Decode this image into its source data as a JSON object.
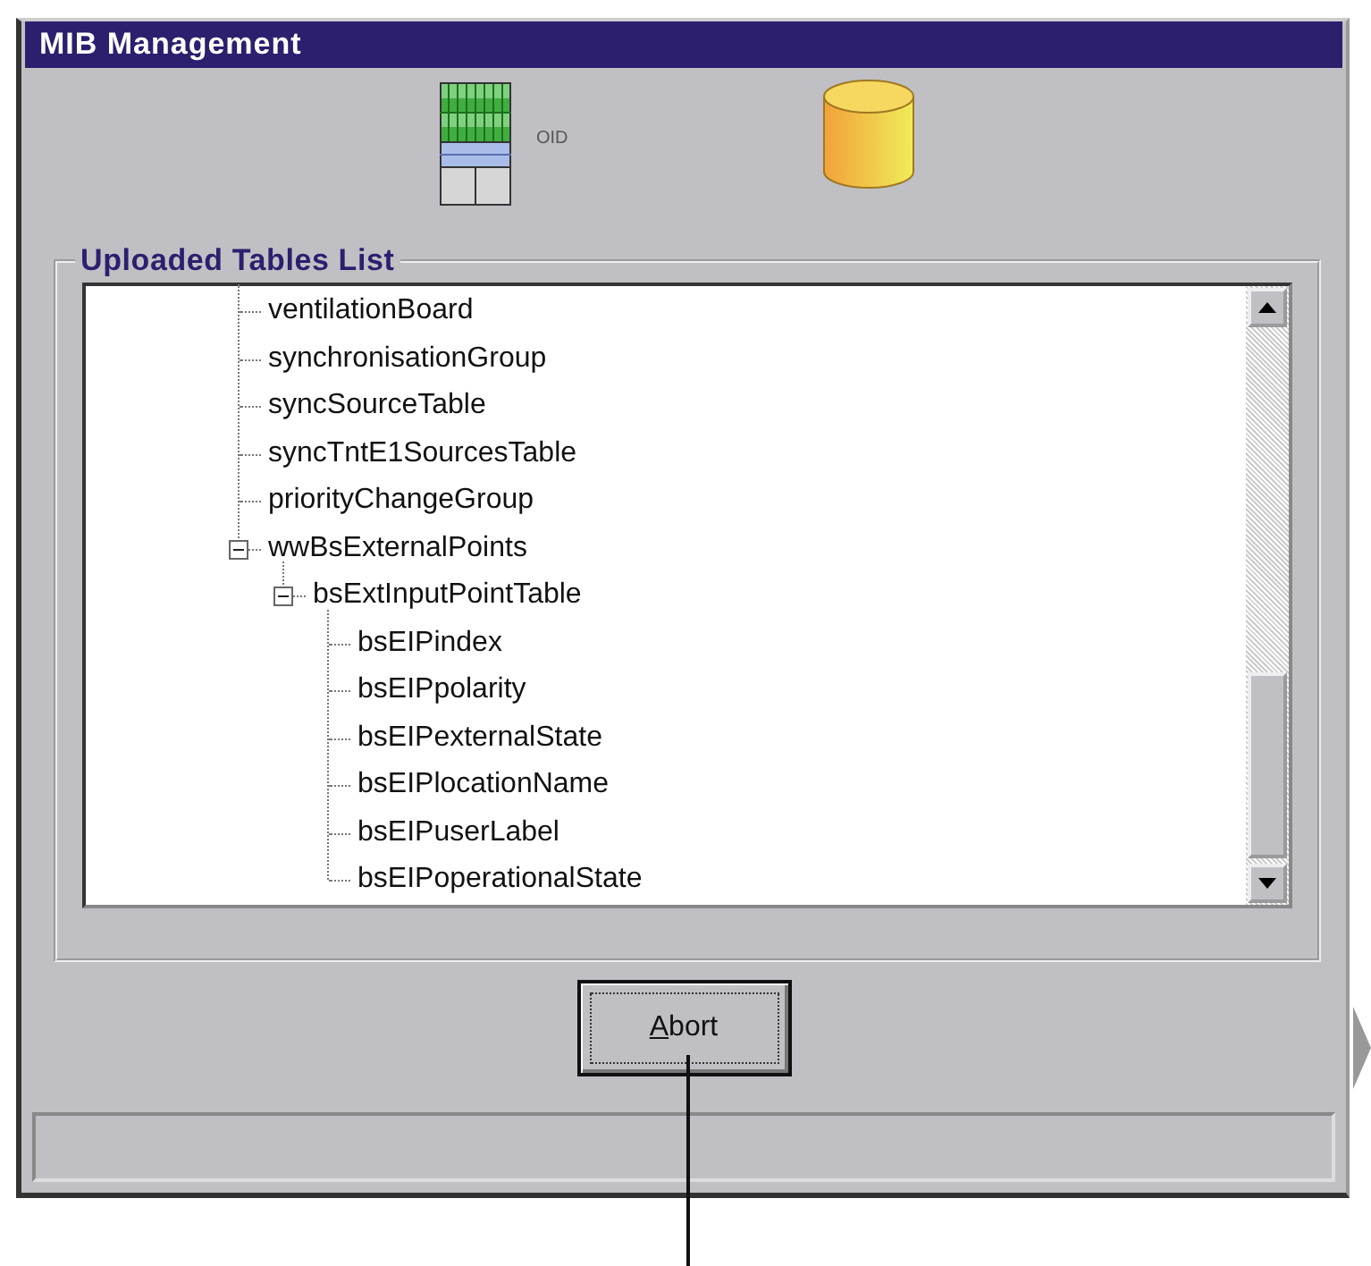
{
  "window": {
    "title": "MIB Management"
  },
  "toolbar": [
    {
      "kind": "table",
      "caption": "OID"
    },
    {
      "kind": "database"
    }
  ],
  "group": {
    "title": "Uploaded Tables List"
  },
  "tree": [
    {
      "label": "ventilationBoard"
    },
    {
      "label": "synchronisationGroup"
    },
    {
      "label": "syncSourceTable"
    },
    {
      "label": "syncTntE1SourcesTable"
    },
    {
      "label": "priorityChangeGroup"
    },
    {
      "label": "wwBsExternalPoints",
      "expanded": true,
      "children": [
        {
          "label": "bsExtInputPointTable",
          "expanded": true,
          "children": [
            {
              "label": "bsEIPindex"
            },
            {
              "label": "bsEIPpolarity"
            },
            {
              "label": "bsEIPexternalState"
            },
            {
              "label": "bsEIPlocationName"
            },
            {
              "label": "bsEIPuserLabel"
            },
            {
              "label": "bsEIPoperationalState"
            }
          ]
        }
      ]
    }
  ],
  "button": {
    "label": "Abort",
    "focused": true
  }
}
